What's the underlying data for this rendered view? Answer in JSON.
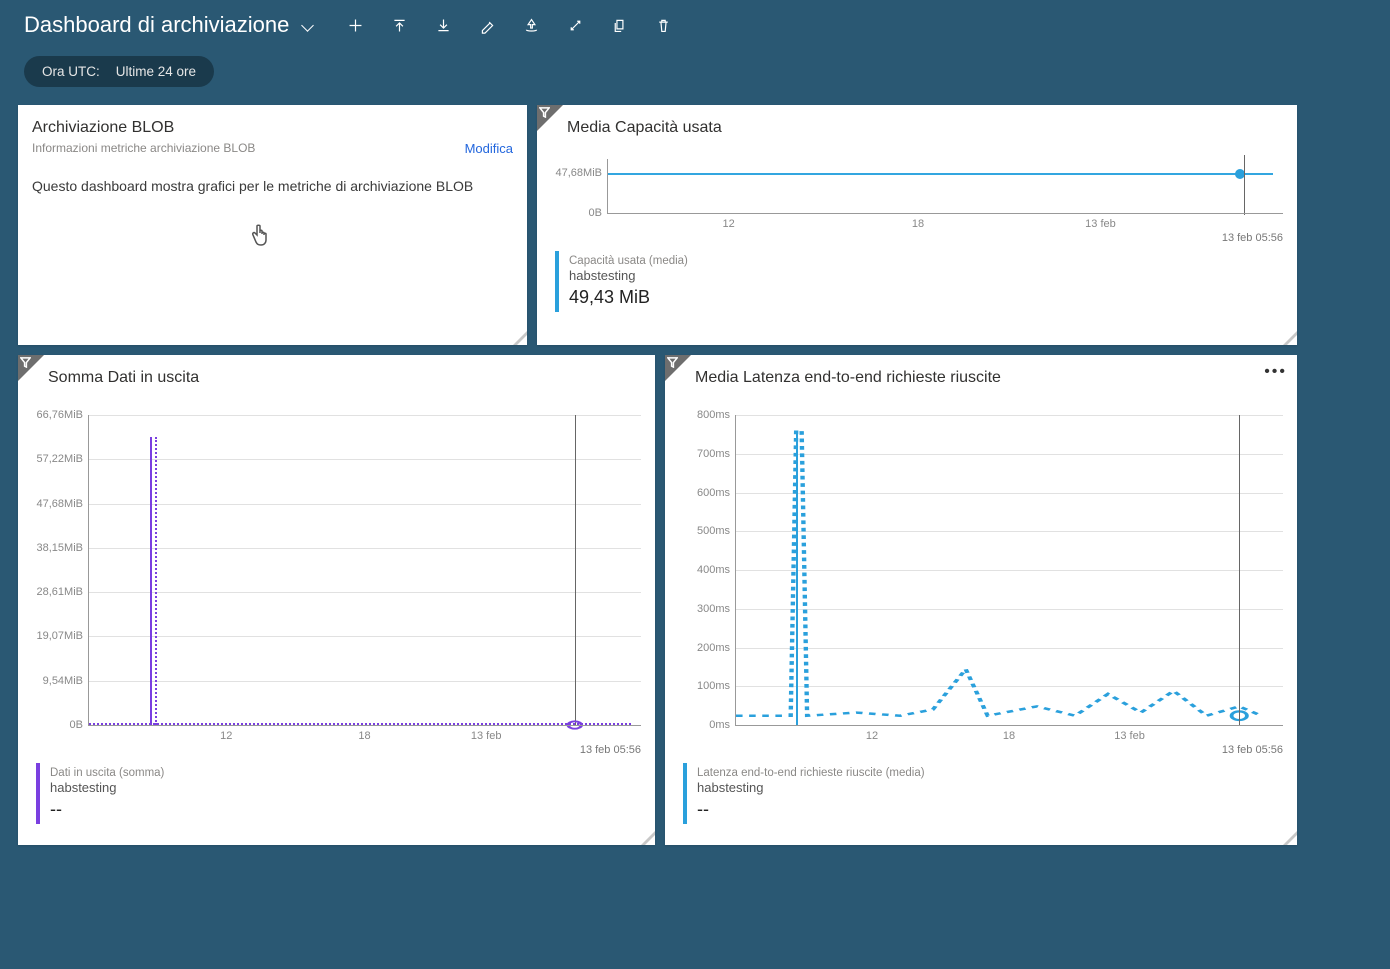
{
  "header": {
    "title": "Dashboard di archiviazione"
  },
  "time_filter": {
    "label": "Ora UTC:",
    "value": "Ultime 24 ore"
  },
  "tiles": {
    "blob_info": {
      "title": "Archiviazione BLOB",
      "subtitle": "Informazioni metriche archiviazione BLOB",
      "edit_link": "Modifica",
      "body": "Questo dashboard mostra grafici per le metriche di archiviazione BLOB"
    },
    "capacity": {
      "title": "Media Capacità usata",
      "y_top": "47,68MiB",
      "y_bottom": "0B",
      "x_ticks": [
        "12",
        "18",
        "13 feb"
      ],
      "x_marker": "13 feb 05:56",
      "legend_label": "Capacità usata (media)",
      "legend_resource": "habstesting",
      "legend_value": "49,43 MiB"
    },
    "egress": {
      "title": "Somma Dati in uscita",
      "y_ticks": [
        "66,76MiB",
        "57,22MiB",
        "47,68MiB",
        "38,15MiB",
        "28,61MiB",
        "19,07MiB",
        "9,54MiB",
        "0B"
      ],
      "x_ticks": [
        "12",
        "18",
        "13 feb"
      ],
      "x_marker": "13 feb 05:56",
      "legend_label": "Dati in uscita (somma)",
      "legend_resource": "habstesting",
      "legend_value": "--"
    },
    "latency": {
      "title": "Media Latenza end-to-end richieste riuscite",
      "y_ticks": [
        "800ms",
        "700ms",
        "600ms",
        "500ms",
        "400ms",
        "300ms",
        "200ms",
        "100ms",
        "0ms"
      ],
      "x_ticks": [
        "12",
        "18",
        "13 feb"
      ],
      "x_marker": "13 feb 05:56",
      "legend_label": "Latenza end-to-end richieste riuscite (media)",
      "legend_resource": "habstesting",
      "legend_value": "--"
    }
  },
  "colors": {
    "capacity": "#2aa0dc",
    "egress": "#7a3fe0",
    "latency": "#2aa0dc"
  },
  "chart_data": [
    {
      "type": "line",
      "title": "Media Capacità usata",
      "series": [
        {
          "name": "Capacità usata (media)",
          "unit": "MiB",
          "values_approx": "flat ~47.7 MiB across range; scalar 49,43 MiB"
        }
      ],
      "x_categories": [
        "12",
        "18",
        "13 feb"
      ],
      "ylim": [
        "0B",
        "47,68MiB"
      ]
    },
    {
      "type": "line",
      "title": "Somma Dati in uscita",
      "series": [
        {
          "name": "Dati in uscita (somma)",
          "unit": "MiB",
          "values_approx": "single spike ~62 MiB near start then ~0"
        }
      ],
      "x_categories": [
        "12",
        "18",
        "13 feb"
      ],
      "y_ticks": [
        "0B",
        "9,54MiB",
        "19,07MiB",
        "28,61MiB",
        "38,15MiB",
        "47,68MiB",
        "57,22MiB",
        "66,76MiB"
      ]
    },
    {
      "type": "line",
      "title": "Media Latenza end-to-end richieste riuscite",
      "series": [
        {
          "name": "Latenza end-to-end richieste riuscite (media)",
          "unit": "ms",
          "values_approx": "spike ~760ms near start then 20–150ms oscillation"
        }
      ],
      "x_categories": [
        "12",
        "18",
        "13 feb"
      ],
      "y_ticks": [
        "0ms",
        "100ms",
        "200ms",
        "300ms",
        "400ms",
        "500ms",
        "600ms",
        "700ms",
        "800ms"
      ]
    }
  ]
}
